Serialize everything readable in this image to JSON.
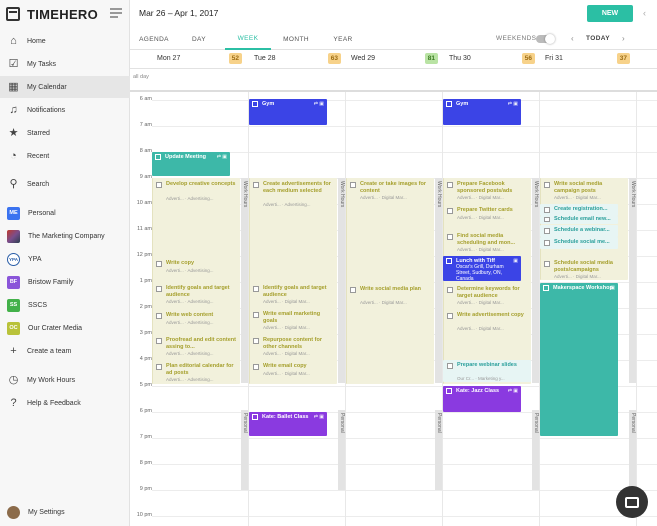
{
  "app": {
    "name": "TIMEHERO"
  },
  "sidebar": {
    "items": [
      {
        "label": "Home",
        "icon": "home-icon"
      },
      {
        "label": "My Tasks",
        "icon": "check-box-icon"
      },
      {
        "label": "My Calendar",
        "icon": "calendar-icon",
        "active": true
      },
      {
        "label": "Notifications",
        "icon": "bell-icon"
      },
      {
        "label": "Starred",
        "icon": "star-icon"
      },
      {
        "label": "Recent",
        "icon": "clock-history-icon"
      },
      {
        "label": "Search",
        "icon": "search-icon"
      }
    ],
    "projects": [
      {
        "label": "Personal",
        "badge": "ME",
        "color": "#3b73f0"
      },
      {
        "label": "The Marketing Company",
        "badge": "",
        "color": "#7a4e8c"
      },
      {
        "label": "YPA",
        "badge": "YPA",
        "color": "#ffffff"
      },
      {
        "label": "Bristow Family",
        "badge": "BF",
        "color": "#8a55d9"
      },
      {
        "label": "SSCS",
        "badge": "SS",
        "color": "#43b14a"
      },
      {
        "label": "Our Crater Media",
        "badge": "OC",
        "color": "#b9c23a"
      }
    ],
    "create_team": "Create a team",
    "footer": [
      {
        "label": "My Work Hours",
        "icon": "clock-icon"
      },
      {
        "label": "Help & Feedback",
        "icon": "help-icon"
      }
    ],
    "settings": "My Settings"
  },
  "header": {
    "date_range": "Mar 26 – Apr 1, 2017",
    "new_button": "NEW"
  },
  "views": {
    "tabs": [
      "AGENDA",
      "DAY",
      "WEEK",
      "MONTH",
      "YEAR"
    ],
    "active": "WEEK",
    "weekends_label": "WEEKENDS",
    "today_label": "TODAY"
  },
  "days": [
    {
      "name": "Mon 27",
      "count": "52"
    },
    {
      "name": "Tue 28",
      "count": "63"
    },
    {
      "name": "Wed 29",
      "count": "81"
    },
    {
      "name": "Thu 30",
      "count": "56"
    },
    {
      "name": "Fri 31",
      "count": "37"
    }
  ],
  "all_day_label": "all day",
  "times": [
    "6 am",
    "7 am",
    "8 am",
    "9 am",
    "10 am",
    "11 am",
    "12 pm",
    "1 pm",
    "2 pm",
    "3 pm",
    "4 pm",
    "5 pm",
    "6 pm",
    "7 pm",
    "8 pm",
    "9 pm",
    "10 pm"
  ],
  "vbar_labels": {
    "work": "Work Hours",
    "personal": "Personal"
  },
  "events": {
    "gym_tue": "Gym",
    "gym_thu": "Gym",
    "update_meeting": "Update Meeting",
    "lunch_title": "Lunch with Tiff",
    "lunch_sub": "Oscar's Grill, Durham Street, Sudbury, ON, Canada",
    "makerspace": "Makerspace Workshop",
    "ballet": "Kate: Ballet Class",
    "jazz": "Kate: Jazz Class"
  },
  "tasks": {
    "mon": [
      {
        "title": "Develop creative concepts",
        "meta": "Adverti... · Advertising..."
      },
      {
        "title": "Write copy",
        "meta": "Adverti... · Advertising..."
      },
      {
        "title": "Identify goals and target audience",
        "meta": "Adverti... · Advertising..."
      },
      {
        "title": "Write web content",
        "meta": "Adverti... · Advertising..."
      },
      {
        "title": "Proofread and edit content assing to...",
        "meta": "Adverti... · Advertising..."
      },
      {
        "title": "Plan editorial calendar for ad posts",
        "meta": "Adverti... · Advertising..."
      }
    ],
    "tue": [
      {
        "title": "Create advertisements for each medium selected",
        "meta": "Adverti... · Advertising..."
      },
      {
        "title": "Identify goals and target audience",
        "meta": "Adverti... · Digital Mar..."
      },
      {
        "title": "Write email marketing goals",
        "meta": "Adverti... · Digital Mar..."
      },
      {
        "title": "Repurpose content for other channels",
        "meta": "Adverti... · Digital Mar..."
      },
      {
        "title": "Write email copy",
        "meta": "Adverti... · Digital Mar..."
      }
    ],
    "wed": [
      {
        "title": "Create or take images for content",
        "meta": "Adverti... · Digital Mar..."
      },
      {
        "title": "Write social media plan",
        "meta": "Adverti... · Digital Mar..."
      }
    ],
    "thu": [
      {
        "title": "Prepare Facebook sponsored posts/ads",
        "meta": "Adverti... · Digital Mar..."
      },
      {
        "title": "Prepare Twitter cards",
        "meta": "Adverti... · Digital Mar..."
      },
      {
        "title": "Find social media scheduling and mon...",
        "meta": "Adverti... · Digital Mar..."
      },
      {
        "title": "Determine keywords for target audience",
        "meta": "Adverti... · Digital Mar..."
      },
      {
        "title": "Write advertisement copy",
        "meta": "Adverti... · Digital Mar..."
      },
      {
        "title": "Prepare webinar slides",
        "meta": "Our Cr... · Marketing y..."
      }
    ],
    "fri": [
      {
        "title": "Write social media campaign posts",
        "meta": "Adverti... · Digital Mar..."
      },
      {
        "title": "Create registration...",
        "meta": ""
      },
      {
        "title": "Schedule email new...",
        "meta": ""
      },
      {
        "title": "Schedule a webinar...",
        "meta": ""
      },
      {
        "title": "Schedule social me...",
        "meta": ""
      },
      {
        "title": "Schedule social media posts/campaigns",
        "meta": "Adverti... · Digital Mar..."
      }
    ]
  },
  "colors": {
    "accent": "#2bbfa4",
    "event_blue": "#3b44e6",
    "event_purple": "#8a3ae0",
    "event_teal": "#3db8a8",
    "task_text": "#a59f2c"
  }
}
